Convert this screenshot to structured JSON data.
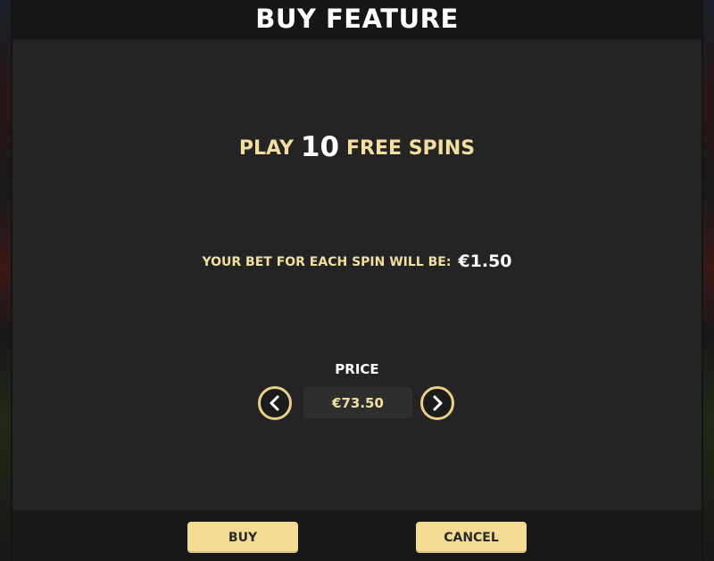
{
  "dialog": {
    "title": "BUY FEATURE",
    "play_prefix": "PLAY",
    "free_spins_count": "10",
    "play_suffix": "FREE SPINS",
    "bet_label": "YOUR BET FOR EACH SPIN WILL BE:",
    "bet_amount": "€1.50",
    "price_label": "PRICE",
    "price_value": "€73.50"
  },
  "controls": {
    "prev_icon": "chevron-left-icon",
    "next_icon": "chevron-right-icon"
  },
  "footer": {
    "buy_label": "BUY",
    "cancel_label": "CANCEL"
  },
  "colors": {
    "accent_gold": "#f2dfa0",
    "button_gold": "#f5dc94",
    "panel_bg": "#242424",
    "title_text": "#ffffff"
  }
}
